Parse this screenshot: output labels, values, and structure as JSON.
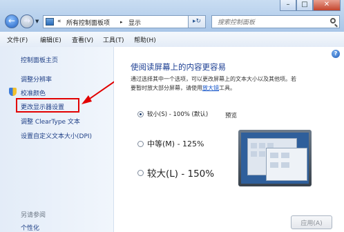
{
  "titlebar": {
    "minimize": "–",
    "maximize": "□",
    "close": "✕"
  },
  "nav": {
    "back_icon": "back-arrow-icon",
    "forward_icon": "forward-arrow-icon"
  },
  "address": {
    "chevrons": "«",
    "crumb_parent": "所有控制面板项",
    "separator": "▸",
    "crumb_current": "显示"
  },
  "search": {
    "placeholder": "搜索控制面板"
  },
  "menu": {
    "file": "文件(F)",
    "edit": "编辑(E)",
    "view": "查看(V)",
    "tools": "工具(T)",
    "help": "帮助(H)"
  },
  "sidebar": {
    "home": "控制面板主页",
    "resolution": "调整分辨率",
    "calibrate": "校准颜色",
    "display_settings": "更改显示器设置",
    "cleartype": "调整 ClearType 文本",
    "custom_dpi": "设置自定义文本大小(DPI)",
    "see_also": "另请参阅",
    "personalize": "个性化"
  },
  "main": {
    "heading": "使阅读屏幕上的内容更容易",
    "desc_line1": "通过选择其中一个选项，可以更改屏幕上的文本大小以及其他项。若",
    "desc_line2_prefix": "要暂时放大部分屏幕，请使用",
    "desc_link": "放大镜",
    "desc_line2_suffix": "工具。",
    "options": [
      {
        "label": "较小(S) - 100% (默认)",
        "selected": true
      },
      {
        "label": "中等(M) - 125%",
        "selected": false
      },
      {
        "label": "较大(L) - 150%",
        "selected": false
      }
    ],
    "preview_label": "预览",
    "apply_button": "应用(A)"
  },
  "colors": {
    "annotation": "#e20000",
    "link": "#1f3f86",
    "heading": "#1c3f93"
  }
}
